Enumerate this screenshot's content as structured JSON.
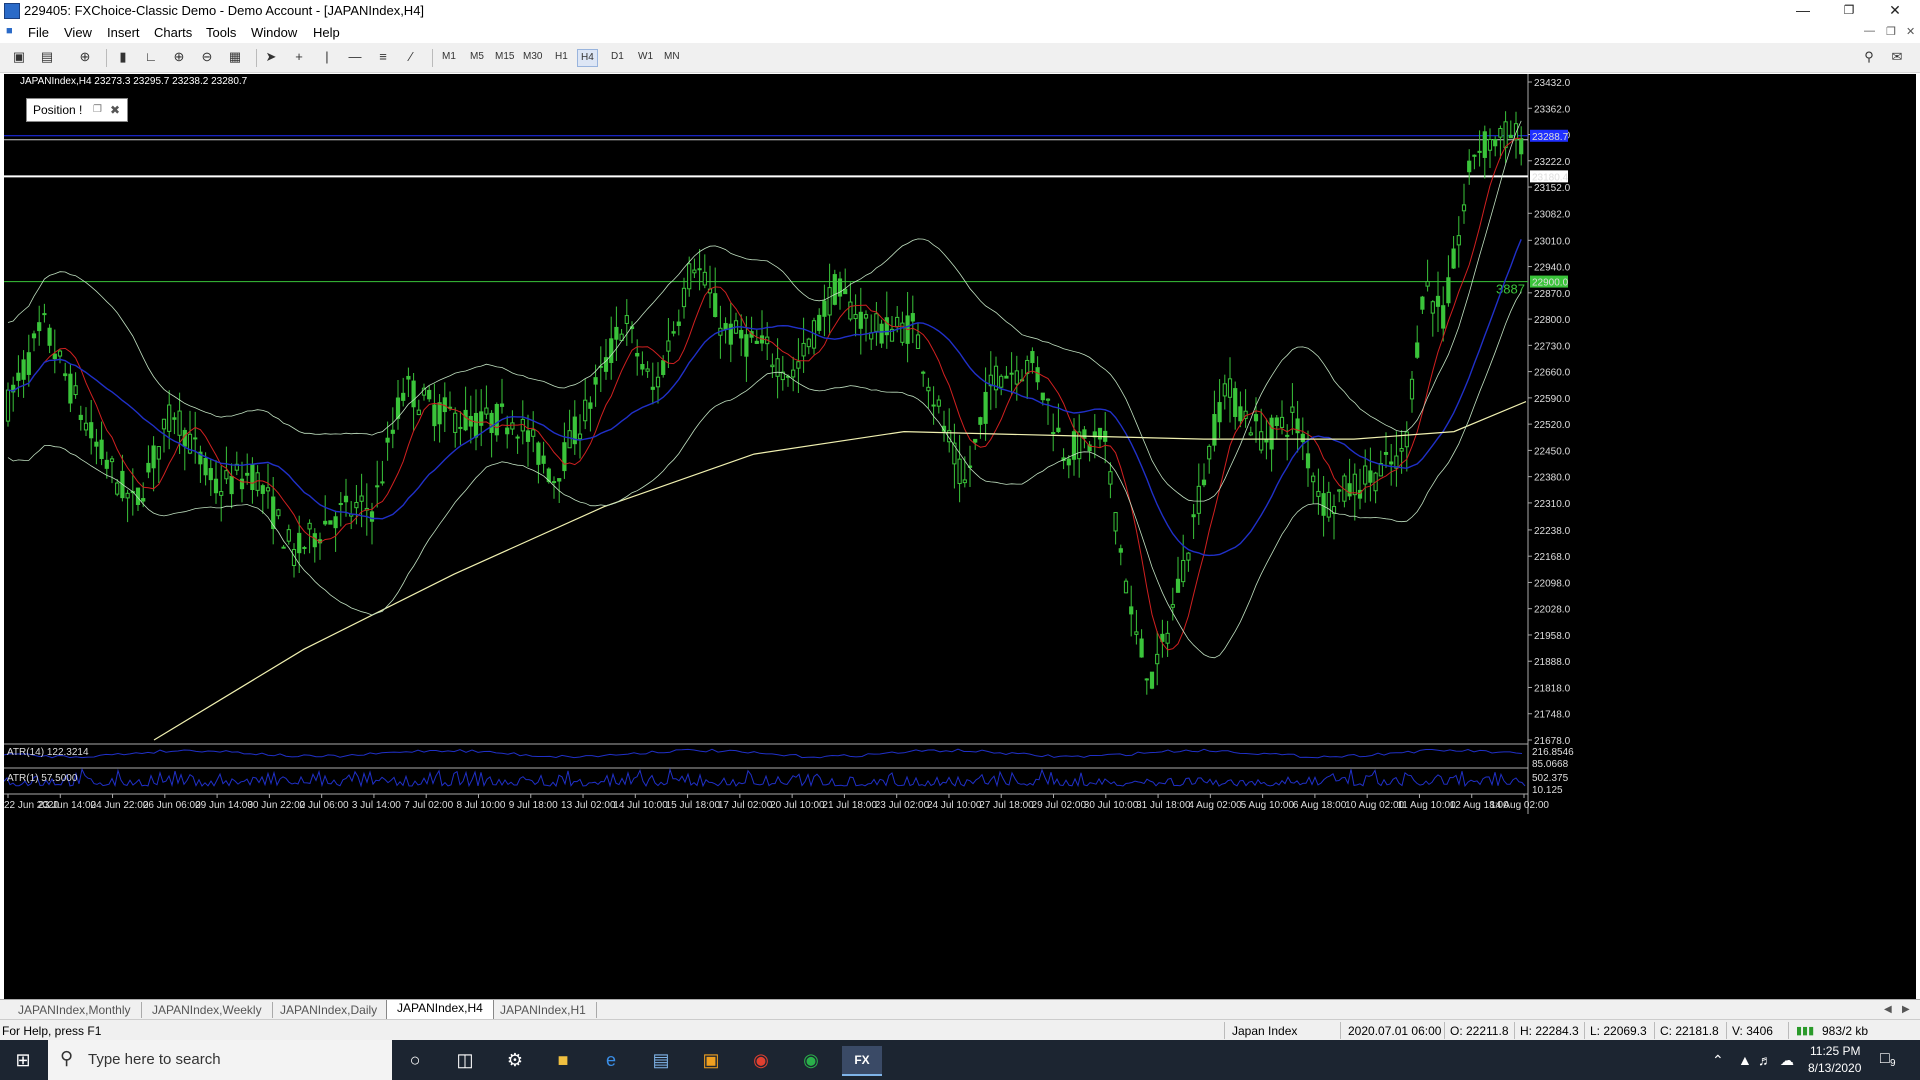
{
  "window": {
    "title": "229405: FXChoice-Classic Demo - Demo Account - [JAPANIndex,H4]"
  },
  "menu": [
    "File",
    "View",
    "Insert",
    "Charts",
    "Tools",
    "Window",
    "Help"
  ],
  "toolbar": {
    "timeframes": [
      "M1",
      "M5",
      "M15",
      "M30",
      "H1",
      "H4",
      "D1",
      "W1",
      "MN"
    ],
    "active_timeframe": "H4"
  },
  "chart": {
    "info": "JAPANIndex,H4  23273.3 23295.7 23238.2 23280.7",
    "position_window_label": "Position !",
    "price_labels": [
      "23432.0",
      "23362.0",
      "23292.0",
      "23222.0",
      "23152.0",
      "23082.0",
      "23010.0",
      "22940.0",
      "22870.0",
      "22800.0",
      "22730.0",
      "22660.0",
      "22590.0",
      "22520.0",
      "22450.0",
      "22380.0",
      "22310.0",
      "22238.0",
      "22168.0",
      "22098.0",
      "22028.0",
      "21958.0",
      "21888.0",
      "21818.0",
      "21748.0",
      "21678.0"
    ],
    "price_tags": [
      {
        "text": "23288.7",
        "color": "#2030ff"
      },
      {
        "text": "23180.4",
        "color": "#ffffff"
      },
      {
        "text": "22900.0",
        "color": "#3ac43a"
      }
    ],
    "level_label": "3887",
    "time_labels": [
      "22 Jun 2020",
      "23 Jun 14:00",
      "24 Jun 22:00",
      "26 Jun 06:00",
      "29 Jun 14:00",
      "30 Jun 22:00",
      "2 Jul 06:00",
      "3 Jul 14:00",
      "7 Jul 02:00",
      "8 Jul 10:00",
      "9 Jul 18:00",
      "13 Jul 02:00",
      "14 Jul 10:00",
      "15 Jul 18:00",
      "17 Jul 02:00",
      "20 Jul 10:00",
      "21 Jul 18:00",
      "23 Jul 02:00",
      "24 Jul 10:00",
      "27 Jul 18:00",
      "29 Jul 02:00",
      "30 Jul 10:00",
      "31 Jul 18:00",
      "4 Aug 02:00",
      "5 Aug 10:00",
      "6 Aug 18:00",
      "10 Aug 02:00",
      "11 Aug 10:00",
      "12 Aug 18:00",
      "14 Aug 02:00"
    ],
    "atr14": {
      "label": "ATR(14) 122.3214",
      "scale": [
        "216.8546",
        "85.0668"
      ]
    },
    "atr1": {
      "label": "ATR(1) 57.5000",
      "scale": [
        "502.375",
        "10.125"
      ]
    },
    "colors": {
      "candles": "#3ac43a",
      "ma_fast": "#d02020",
      "ma_mid": "#2030c8",
      "ma_slow": "#f0f0b0",
      "bands": "#c0e0c0"
    }
  },
  "tabs": [
    "JAPANIndex,Monthly",
    "JAPANIndex,Weekly",
    "JAPANIndex,Daily",
    "JAPANIndex,H4",
    "JAPANIndex,H1"
  ],
  "active_tab": "JAPANIndex,H4",
  "status": {
    "help": "For Help, press F1",
    "symbol": "Japan Index",
    "datetime": "2020.07.01 06:00",
    "open": "O: 22211.8",
    "high": "H: 22284.3",
    "low": "L: 22069.3",
    "close": "C: 22181.8",
    "volume": "V: 3406",
    "traffic": "983/2 kb"
  },
  "taskbar": {
    "search_placeholder": "Type here to search",
    "time": "11:25 PM",
    "date": "8/13/2020",
    "notification_count": "9"
  }
}
